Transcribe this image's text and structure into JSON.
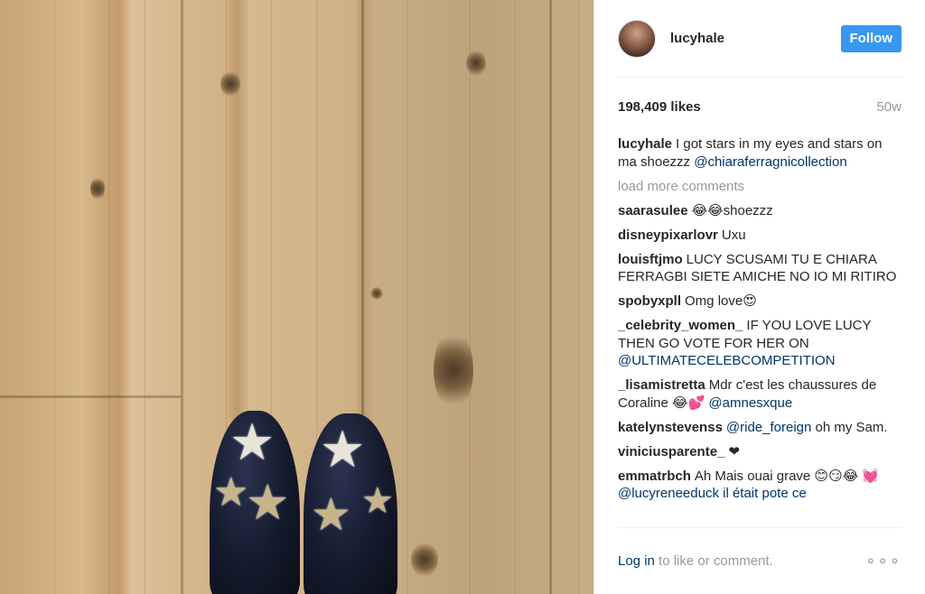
{
  "post": {
    "username": "lucyhale",
    "follow_label": "Follow",
    "likes": "198,409 likes",
    "age": "50w",
    "caption": {
      "user": "lucyhale",
      "text": "I got stars in my eyes and stars on ma shoezzz",
      "mention": "@chiaraferragnicollection"
    },
    "load_more_label": "load more comments",
    "comments": [
      {
        "user": "saarasulee",
        "text": "😂😂shoezzz"
      },
      {
        "user": "disneypixarlovr",
        "text": "Uxu"
      },
      {
        "user": "louisftjmo",
        "text": "LUCY SCUSAMI TU E CHIARA FERRAGBI SIETE AMICHE NO IO MI RITIRO"
      },
      {
        "user": "spobyxpll",
        "text": "Omg love😍"
      },
      {
        "user": "_celebrity_women_",
        "text": "IF YOU LOVE LUCY THEN GO VOTE FOR HER ON",
        "mention": "@ULTIMATECELEBCOMPETITION"
      },
      {
        "user": "_lisamistretta",
        "text": "Mdr c'est les chaussures de Coraline 😂💕",
        "mention": "@amnesxque"
      },
      {
        "user": "katelynstevenss",
        "mention": "@ride_foreign",
        "text_after": "oh my Sam."
      },
      {
        "user": "viniciusparente_",
        "text": "❤"
      },
      {
        "user": "emmatrbch",
        "text": "Ah Mais ouai grave 😊😏😂",
        "mention": "💓 @lucyreneeduck il était pote ce"
      }
    ],
    "footer": {
      "login_label": "Log in",
      "rest_label": "to like or comment.",
      "more_icon": "..."
    }
  }
}
